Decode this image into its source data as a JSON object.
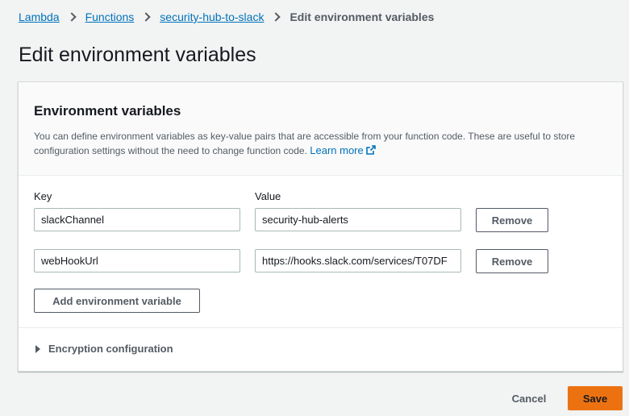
{
  "breadcrumb": {
    "items": [
      "Lambda",
      "Functions",
      "security-hub-to-slack"
    ],
    "current": "Edit environment variables"
  },
  "page_title": "Edit environment variables",
  "panel": {
    "title": "Environment variables",
    "description": "You can define environment variables as key-value pairs that are accessible from your function code. These are useful to store configuration settings without the need to change function code.",
    "learn_more": "Learn more",
    "key_label": "Key",
    "value_label": "Value",
    "variables": [
      {
        "key": "slackChannel",
        "value": "security-hub-alerts",
        "remove_label": "Remove"
      },
      {
        "key": "webHookUrl",
        "value": "https://hooks.slack.com/services/T07DF",
        "remove_label": "Remove"
      }
    ],
    "add_label": "Add environment variable",
    "encryption_label": "Encryption configuration"
  },
  "footer": {
    "cancel_label": "Cancel",
    "save_label": "Save"
  },
  "colors": {
    "link": "#0073bb",
    "primary": "#ec7211",
    "text_secondary": "#545b64"
  },
  "icons": [
    "chevron-right-icon",
    "external-link-icon",
    "caret-right-icon"
  ]
}
